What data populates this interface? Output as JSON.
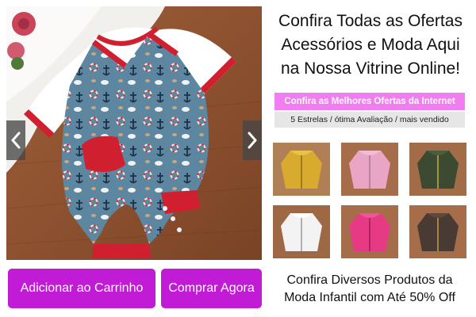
{
  "headline": {
    "line1": "Confira Todas as Ofertas",
    "line2": "Acessórios e Moda Aqui",
    "line3": "na Nossa Vitrine Online!"
  },
  "offer_banner": "Confira as Melhores Ofertas da Internet",
  "rating_bar": "5 Estrelas  /  ótima Avaliação  /  mais vendido",
  "carousel": {
    "prev_icon": "chevron-left-icon",
    "next_icon": "chevron-right-icon"
  },
  "thumbnails": [
    {
      "name": "jaqueta-amarela",
      "color": "#d8ab2e"
    },
    {
      "name": "jaqueta-rosa-clara",
      "color": "#e8a5c4"
    },
    {
      "name": "jaqueta-verde",
      "color": "#3b4a30"
    },
    {
      "name": "jaqueta-branca",
      "color": "#f3f3f3"
    },
    {
      "name": "jaqueta-pink",
      "color": "#e63a84"
    },
    {
      "name": "jaqueta-marrom",
      "color": "#4a3a34"
    }
  ],
  "buttons": {
    "add_to_cart": "Adicionar ao Carrinho",
    "buy_now": "Comprar Agora"
  },
  "promo": {
    "line1": "Confira Diversos Produtos da",
    "line2": "Moda Infantil com Até 50% Off"
  },
  "colors": {
    "accent": "#c21bd6",
    "banner": "#f07ef0",
    "rating_bg": "#e6e6e6"
  }
}
